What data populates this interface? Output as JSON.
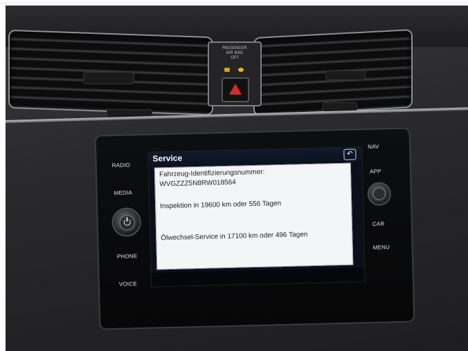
{
  "airbag_panel": {
    "line1": "PASSENGER",
    "line2": "AIR BAG",
    "line3": "OFF"
  },
  "left_buttons": [
    "RADIO",
    "MEDIA",
    "PHONE",
    "VOICE"
  ],
  "right_buttons": [
    "NAV",
    "APP",
    "CAR",
    "MENU"
  ],
  "screen": {
    "title": "Service",
    "back_icon": "back-arrow-icon",
    "lines": [
      "Fahrzeug-Identifizierungsnummer:",
      "WVGZZZ5N8RW018564",
      "Inspektion in 19600 km oder 556 Tagen",
      "Ölwechsel-Service in 17100 km oder 496 Tagen"
    ]
  }
}
